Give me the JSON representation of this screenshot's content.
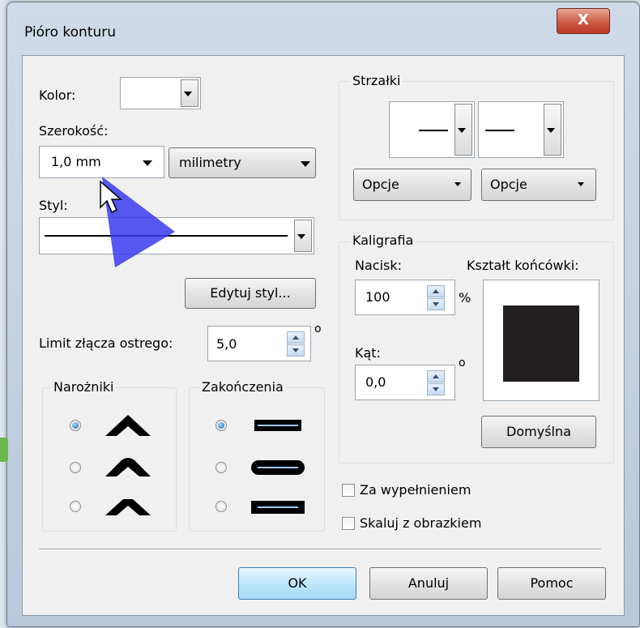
{
  "dialog": {
    "title": "Pióro konturu",
    "close_label": "X"
  },
  "color": {
    "label": "Kolor:"
  },
  "width": {
    "label": "Szerokość:",
    "value": "1,0 mm",
    "unit": "milimetry"
  },
  "style": {
    "label": "Styl:",
    "edit_button": "Edytuj styl..."
  },
  "miter": {
    "label": "Limit złącza ostrego:",
    "value": "5,0",
    "unit": "o"
  },
  "corners": {
    "title": "Narożniki",
    "selected": 0
  },
  "caps": {
    "title": "Zakończenia",
    "selected": 0
  },
  "arrows": {
    "title": "Strzałki",
    "options_left": "Opcje",
    "options_right": "Opcje"
  },
  "calligraphy": {
    "title": "Kaligrafia",
    "stretch_label": "Nacisk:",
    "stretch_value": "100",
    "stretch_unit": "%",
    "nib_label": "Kształt końcówki:",
    "angle_label": "Kąt:",
    "angle_value": "0,0",
    "angle_unit": "o",
    "default_button": "Domyślna"
  },
  "checkboxes": {
    "behind_fill": {
      "label": "Za wypełnieniem",
      "checked": false
    },
    "scale_with_image": {
      "label": "Skaluj z obrazkiem",
      "checked": false
    }
  },
  "buttons": {
    "ok": "OK",
    "cancel": "Anuluj",
    "help": "Pomoc"
  },
  "colors": {
    "annotation_arrow": "#3a3af0",
    "nib": "#231f20",
    "window_frame": "#b9c9db"
  }
}
